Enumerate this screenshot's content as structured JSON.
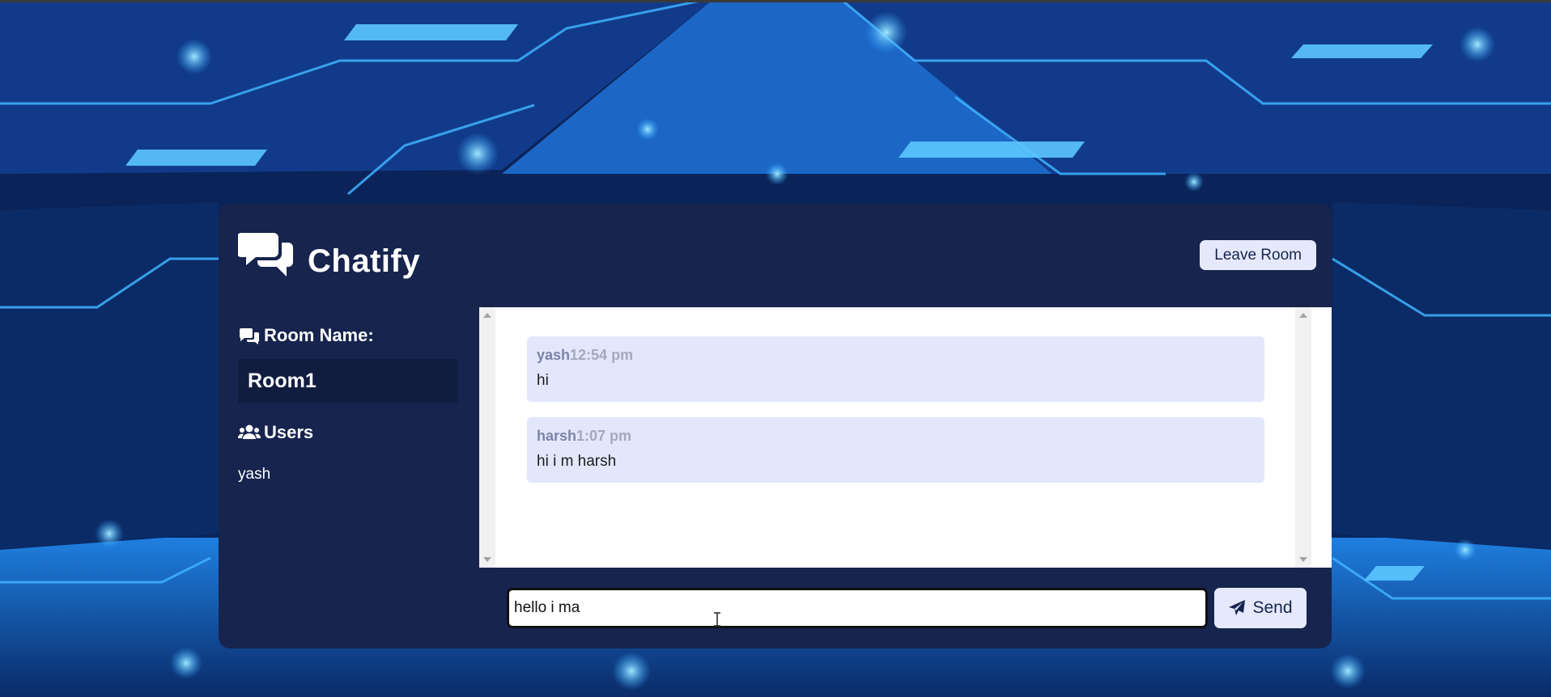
{
  "app": {
    "title": "Chatify",
    "leave_button_label": "Leave Room"
  },
  "sidebar": {
    "room_heading": "Room Name:",
    "room_name": "Room1",
    "users_heading": "Users",
    "users": [
      "yash"
    ]
  },
  "chat": {
    "messages": [
      {
        "user": "yash",
        "time": "12:54 pm",
        "text": "hi"
      },
      {
        "user": "harsh",
        "time": "1:07 pm",
        "text": "hi i m harsh"
      }
    ]
  },
  "form": {
    "input_value": "hello i ma ",
    "send_label": "Send"
  },
  "icons": {
    "logo": "comments-icon",
    "room": "comments-icon",
    "users": "users-icon",
    "send": "paper-plane-icon"
  },
  "colors": {
    "panel": "#16244e",
    "room_box": "#111d40",
    "message_bg": "#e3e7fc",
    "button_bg": "#e6e9fb",
    "meta_user": "#7a84a6",
    "meta_time": "#a5a9bd"
  }
}
